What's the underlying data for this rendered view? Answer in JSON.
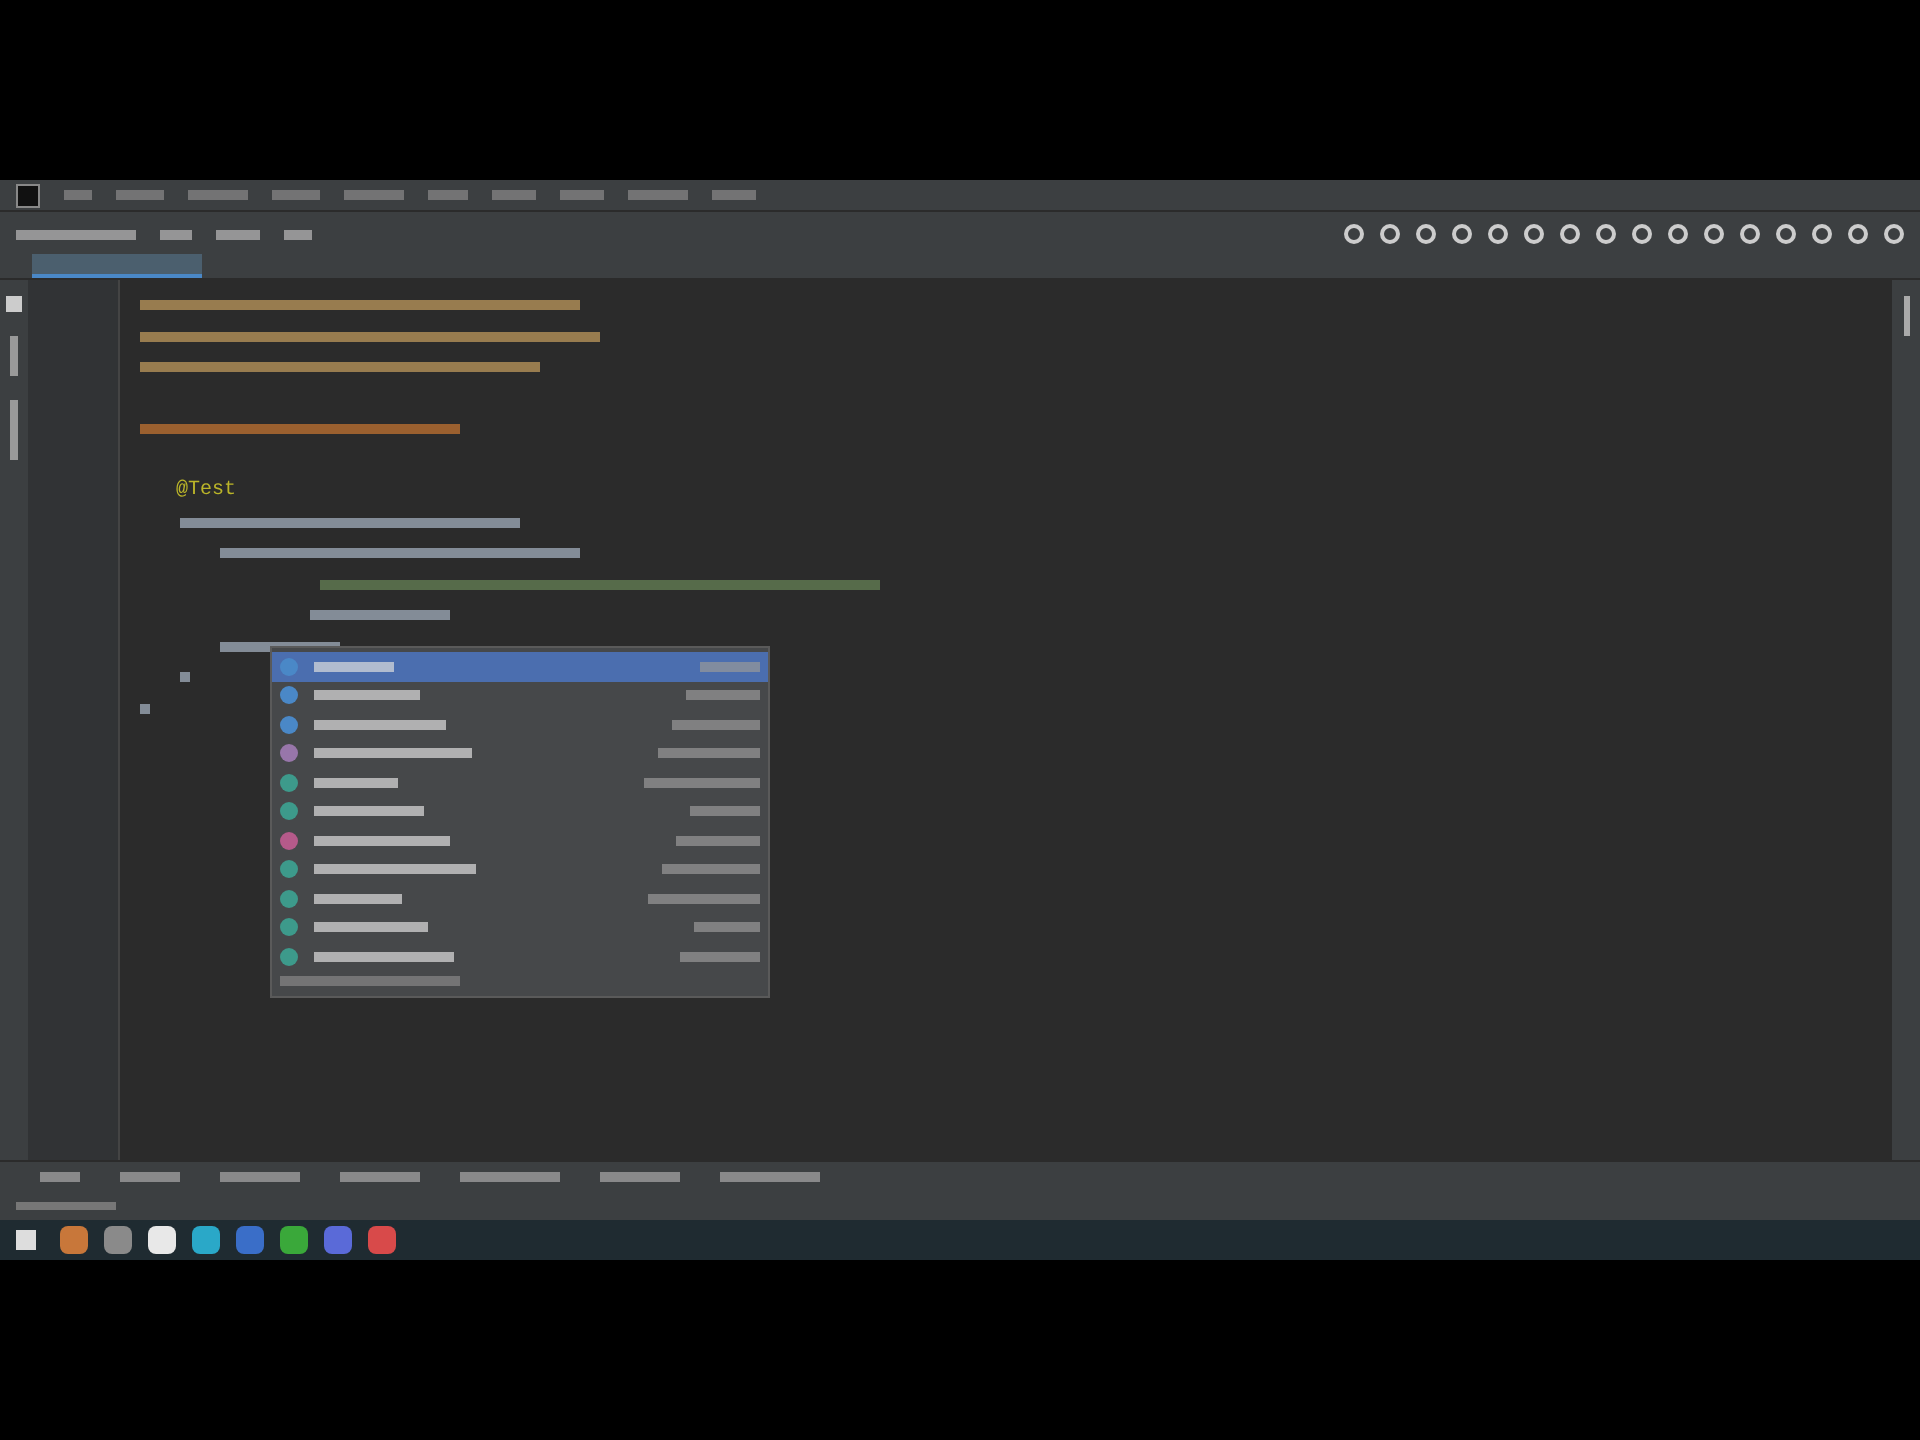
{
  "editor": {
    "annotation": "@Test"
  },
  "completion_popup": {
    "items": [
      {
        "color": "#4a88c7",
        "selected": true
      },
      {
        "color": "#4a88c7",
        "selected": false
      },
      {
        "color": "#4a88c7",
        "selected": false
      },
      {
        "color": "#9876aa",
        "selected": false
      },
      {
        "color": "#3d9a8b",
        "selected": false
      },
      {
        "color": "#3d9a8b",
        "selected": false
      },
      {
        "color": "#b55a8a",
        "selected": false
      },
      {
        "color": "#3d9a8b",
        "selected": false
      },
      {
        "color": "#3d9a8b",
        "selected": false
      },
      {
        "color": "#3d9a8b",
        "selected": false
      },
      {
        "color": "#3d9a8b",
        "selected": false
      }
    ]
  },
  "taskbar": {
    "apps": [
      {
        "color": "#c8773a"
      },
      {
        "color": "#8a8a8a"
      },
      {
        "color": "#e8e8e8"
      },
      {
        "color": "#2aa8c8"
      },
      {
        "color": "#3a6ec8"
      },
      {
        "color": "#3aa83a"
      },
      {
        "color": "#5a6ad8"
      },
      {
        "color": "#d84a4a"
      }
    ]
  }
}
